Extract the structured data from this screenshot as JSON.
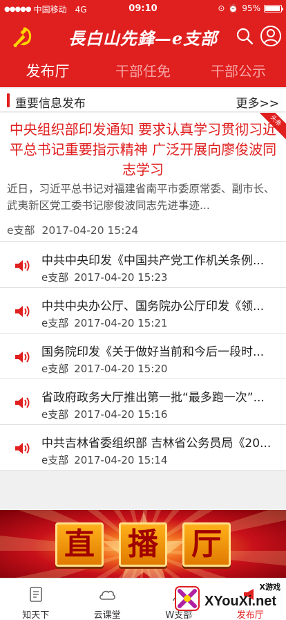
{
  "status_bar": {
    "carrier": "中国移动",
    "network": "4G",
    "time": "09:10",
    "battery": "95%",
    "battery_level": 0.95
  },
  "header": {
    "title": "長白山先鋒—e支部"
  },
  "tabs": [
    {
      "label": "发布厅",
      "active": true
    },
    {
      "label": "干部任免",
      "active": false
    },
    {
      "label": "干部公示",
      "active": false
    }
  ],
  "section": {
    "title": "重要信息发布",
    "more": "更多>>"
  },
  "headline": {
    "tag": "头条",
    "title": "中央组织部印发通知 要求认真学习贯彻习近平总书记重要指示精神 广泛开展向廖俊波同志学习",
    "summary": "近日，习近平总书记对福建省南平市委原常委、副市长、武夷新区党工委书记廖俊波同志先进事迹...",
    "source": "e支部",
    "time": "2017-04-20 15:24"
  },
  "news": [
    {
      "title": "中共中央印发《中国共产党工作机关条例...",
      "source": "e支部",
      "time": "2017-04-20 15:23"
    },
    {
      "title": "中共中央办公厅、国务院办公厅印发《领...",
      "source": "e支部",
      "time": "2017-04-20 15:21"
    },
    {
      "title": "国务院印发《关于做好当前和今后一段时...",
      "source": "e支部",
      "time": "2017-04-20 15:20"
    },
    {
      "title": "省政府政务大厅推出第一批“最多跑一次”...",
      "source": "e支部",
      "time": "2017-04-20 15:16"
    },
    {
      "title": "中共吉林省委组织部 吉林省公务员局《20...",
      "source": "e支部",
      "time": "2017-04-20 15:14"
    }
  ],
  "banner": {
    "chars": [
      "直",
      "播",
      "厅"
    ]
  },
  "bottom_nav": [
    {
      "label": "知天下",
      "icon": "document-icon"
    },
    {
      "label": "云课堂",
      "icon": "cloud-icon"
    },
    {
      "label": "W支部",
      "icon": "group-icon"
    },
    {
      "label": "发布厅",
      "icon": "megaphone-icon"
    }
  ],
  "watermark": {
    "text": "XYouXi.net",
    "small": "X游戏"
  },
  "colors": {
    "brand_red": "#e01f1f",
    "tab_inactive": "#f7a4a4",
    "banner_gold": "#ffb01a"
  }
}
